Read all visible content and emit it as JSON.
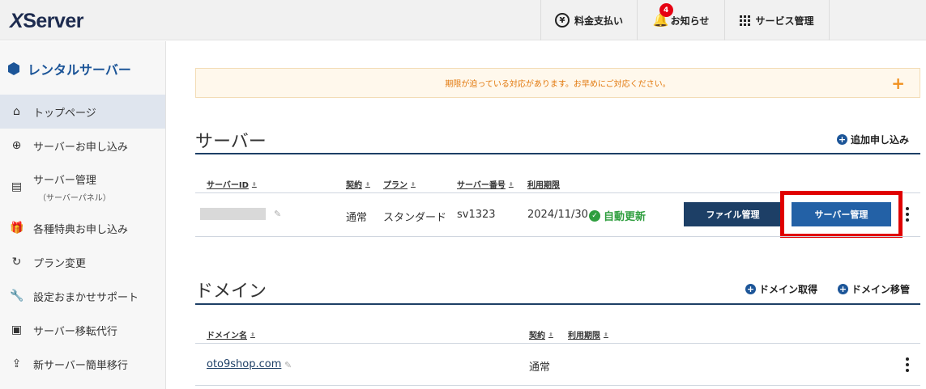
{
  "header": {
    "logo": "XServer",
    "nav": [
      {
        "label": "料金支払い",
        "icon": "yen-icon"
      },
      {
        "label": "お知らせ",
        "icon": "bell-icon",
        "badge": "4"
      },
      {
        "label": "サービス管理",
        "icon": "grid-icon"
      }
    ]
  },
  "sidebar": {
    "title": "レンタルサーバー",
    "items": [
      {
        "label": "トップページ",
        "icon": "home-icon",
        "active": true
      },
      {
        "label": "サーバーお申し込み",
        "icon": "plus-circle-icon"
      },
      {
        "label": "サーバー管理",
        "sub": "（サーバーパネル）",
        "icon": "server-icon"
      },
      {
        "label": "各種特典お申し込み",
        "icon": "gift-icon"
      },
      {
        "label": "プラン変更",
        "icon": "refresh-icon"
      },
      {
        "label": "設定おまかせサポート",
        "icon": "wrench-icon"
      },
      {
        "label": "サーバー移転代行",
        "icon": "server-move-icon"
      },
      {
        "label": "新サーバー簡単移行",
        "icon": "upload-icon"
      }
    ]
  },
  "alert": {
    "text": "期限が迫っている対応があります。お早めにご対応ください。",
    "expand": "+"
  },
  "server_section": {
    "title": "サーバー",
    "add_link": "追加申し込み",
    "columns": [
      "サーバーID",
      "契約",
      "プラン",
      "サーバー番号",
      "利用期限"
    ],
    "row": {
      "contract": "通常",
      "plan": "スタンダード",
      "server_no": "sv1323",
      "expiry": "2024/11/30",
      "status": "自動更新",
      "file_button": "ファイル管理",
      "server_button": "サーバー管理"
    }
  },
  "domain_section": {
    "title": "ドメイン",
    "links": [
      "ドメイン取得",
      "ドメイン移管"
    ],
    "columns": [
      "ドメイン名",
      "契約",
      "利用期限"
    ],
    "row": {
      "domain": "oto9shop.com",
      "contract": "通常"
    }
  },
  "colors": {
    "primary": "#1d3f66",
    "accent": "#2361a6",
    "alert_text": "#e2780c",
    "success": "#2e9e3e",
    "highlight": "#e00000"
  }
}
